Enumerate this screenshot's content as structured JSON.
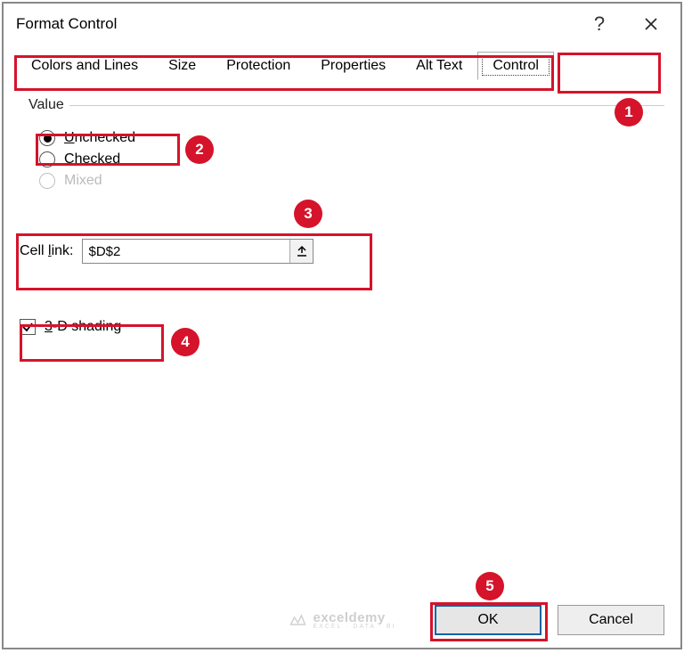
{
  "titlebar": {
    "title": "Format Control"
  },
  "tabs": {
    "items": [
      {
        "label": "Colors and Lines"
      },
      {
        "label": "Size"
      },
      {
        "label": "Protection"
      },
      {
        "label": "Properties"
      },
      {
        "label": "Alt Text"
      },
      {
        "label": "Control"
      }
    ],
    "active_index": 5
  },
  "value_group": {
    "legend": "Value",
    "radios": {
      "unchecked": {
        "prefix": "U",
        "rest": "nchecked",
        "selected": true
      },
      "checked": {
        "prefix": "C",
        "rest": "hecked",
        "selected": false
      },
      "mixed": {
        "label": "Mixed",
        "disabled": true
      }
    }
  },
  "cell_link": {
    "label_prefix": "Cell ",
    "label_ul": "l",
    "label_rest": "ink:",
    "value": "$D$2"
  },
  "shading": {
    "prefix": "3",
    "rest": "-D shading",
    "checked": true
  },
  "buttons": {
    "ok": "OK",
    "cancel": "Cancel"
  },
  "watermark": {
    "brand": "exceldemy",
    "tagline": "EXCEL · DATA · BI"
  },
  "annotations": {
    "badges": {
      "1": "1",
      "2": "2",
      "3": "3",
      "4": "4",
      "5": "5"
    }
  }
}
